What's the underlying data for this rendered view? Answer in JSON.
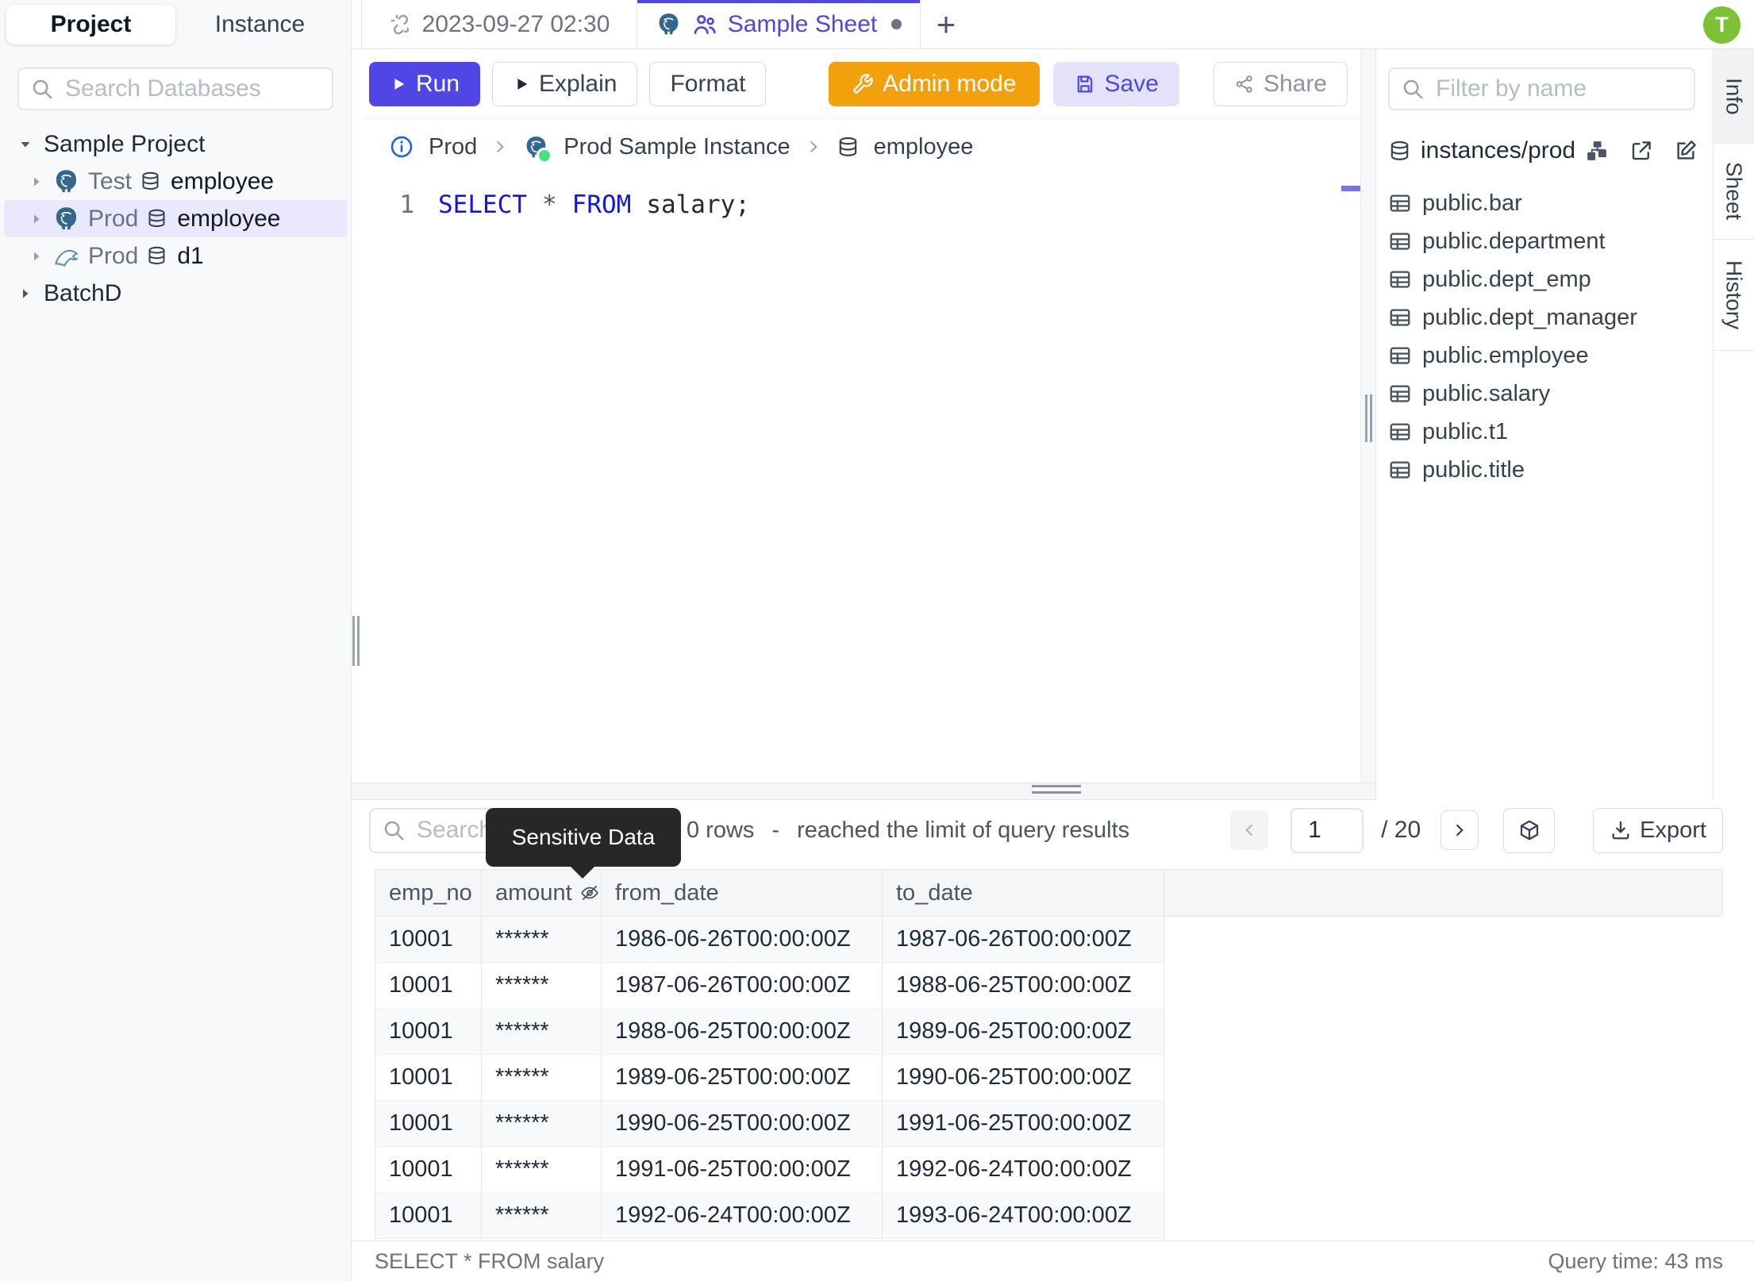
{
  "app": {
    "avatar_initial": "T"
  },
  "colors": {
    "accent": "#4f46e5",
    "admin_orange": "#f2a00c",
    "avatar_green": "#7cc234",
    "status_green": "#4ade80",
    "postgres_blue": "#336791",
    "keyword_blue": "#1116e6"
  },
  "left_sidebar": {
    "tabs": {
      "project": "Project",
      "instance": "Instance"
    },
    "search_placeholder": "Search Databases",
    "tree": {
      "project": "Sample Project",
      "databases": [
        {
          "env": "Test",
          "name": "employee",
          "engine": "postgres"
        },
        {
          "env": "Prod",
          "name": "employee",
          "engine": "postgres"
        },
        {
          "env": "Prod",
          "name": "d1",
          "engine": "mysql"
        }
      ],
      "collapsed_project": "BatchD"
    }
  },
  "tab_bar": {
    "worksheet_tab": "2023-09-27 02:30",
    "active_tab": "Sample Sheet",
    "new_tab": "+"
  },
  "toolbar": {
    "run": "Run",
    "explain": "Explain",
    "format": "Format",
    "admin_mode": "Admin mode",
    "save": "Save",
    "share": "Share"
  },
  "breadcrumb": {
    "environment": "Prod",
    "instance": "Prod Sample Instance",
    "database": "employee"
  },
  "editor": {
    "line_number": "1",
    "sql": {
      "select": "SELECT",
      "star": "*",
      "from": "FROM",
      "rest": "salary;"
    }
  },
  "schema_panel": {
    "filter_placeholder": "Filter by name",
    "group_label": "instances/prod",
    "tables": [
      "public.bar",
      "public.department",
      "public.dept_emp",
      "public.dept_manager",
      "public.employee",
      "public.salary",
      "public.t1",
      "public.title"
    ]
  },
  "right_tabs": {
    "info": "Info",
    "sheet": "Sheet",
    "history": "History"
  },
  "results": {
    "search_placeholder": "Search",
    "tooltip": "Sensitive Data",
    "summary": {
      "rows": "0 rows",
      "dash": "-",
      "note": "reached the limit of query results"
    },
    "pagination": {
      "page": "1",
      "total": "/ 20"
    },
    "export_label": "Export",
    "table": {
      "columns": {
        "c1": "emp_no",
        "c2": "amount",
        "c3": "from_date",
        "c4": "to_date"
      },
      "rows": [
        [
          "10001",
          "******",
          "1986-06-26T00:00:00Z",
          "1987-06-26T00:00:00Z"
        ],
        [
          "10001",
          "******",
          "1987-06-26T00:00:00Z",
          "1988-06-25T00:00:00Z"
        ],
        [
          "10001",
          "******",
          "1988-06-25T00:00:00Z",
          "1989-06-25T00:00:00Z"
        ],
        [
          "10001",
          "******",
          "1989-06-25T00:00:00Z",
          "1990-06-25T00:00:00Z"
        ],
        [
          "10001",
          "******",
          "1990-06-25T00:00:00Z",
          "1991-06-25T00:00:00Z"
        ],
        [
          "10001",
          "******",
          "1991-06-25T00:00:00Z",
          "1992-06-24T00:00:00Z"
        ],
        [
          "10001",
          "******",
          "1992-06-24T00:00:00Z",
          "1993-06-24T00:00:00Z"
        ]
      ]
    },
    "status_left": "SELECT * FROM salary",
    "status_right": "Query time: 43 ms"
  }
}
